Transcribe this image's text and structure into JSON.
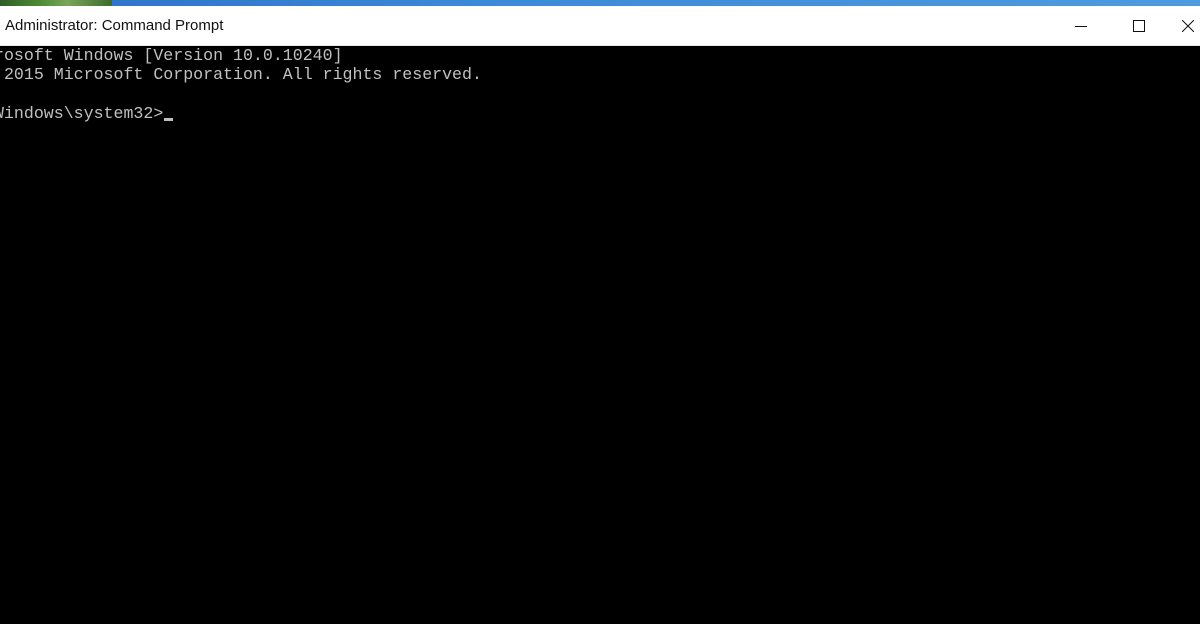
{
  "window": {
    "title": "Administrator: Command Prompt"
  },
  "console": {
    "lines": [
      "rosoft Windows [Version 10.0.10240]",
      " 2015 Microsoft Corporation. All rights reserved.",
      "Windows\\system32>"
    ]
  },
  "controls": {
    "minimize_icon": "minimize-icon",
    "maximize_icon": "maximize-icon",
    "close_icon": "close-icon"
  },
  "colors": {
    "console_background": "#000000",
    "console_text": "#c0c0c0",
    "titlebar_background": "#ffffff"
  }
}
